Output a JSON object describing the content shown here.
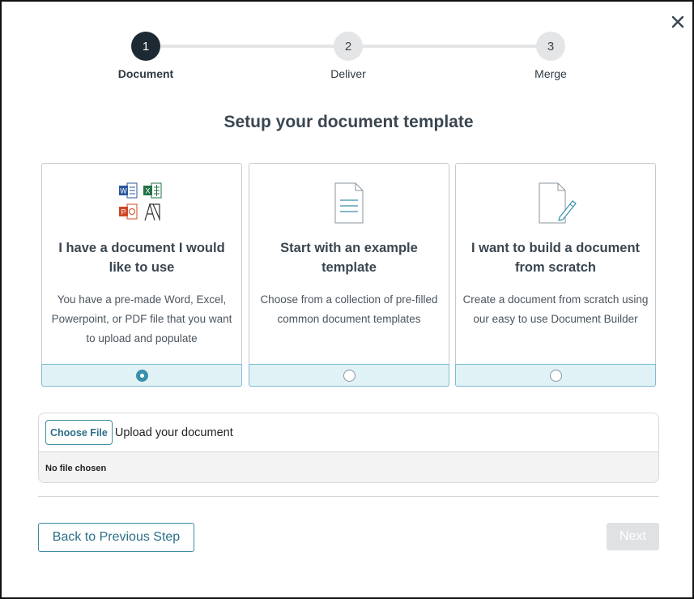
{
  "stepper": {
    "steps": [
      {
        "number": "1",
        "label": "Document",
        "state": "active"
      },
      {
        "number": "2",
        "label": "Deliver",
        "state": "inactive"
      },
      {
        "number": "3",
        "label": "Merge",
        "state": "inactive"
      }
    ]
  },
  "title": "Setup your document template",
  "options": [
    {
      "icon": "office-files-icon",
      "title": "I have a document I would like to use",
      "description": "You have a pre-made Word, Excel, Powerpoint, or PDF file that you want to upload and populate",
      "selected": true
    },
    {
      "icon": "document-template-icon",
      "title": "Start with an example template",
      "description": "Choose from a collection of pre-filled common document templates",
      "selected": false
    },
    {
      "icon": "document-edit-icon",
      "title": "I want to build a document from scratch",
      "description": "Create a document from scratch using our easy to use Document Builder",
      "selected": false
    }
  ],
  "upload": {
    "button_label": "Choose File",
    "label": "Upload your document",
    "status": "No file chosen"
  },
  "footer": {
    "back_label": "Back to Previous Step",
    "next_label": "Next",
    "next_enabled": false
  },
  "colors": {
    "accent": "#3a8fa9",
    "step_active": "#1d2a33",
    "card_footer_bg": "#e1f2f7",
    "next_disabled_bg": "#dfe1e3"
  }
}
